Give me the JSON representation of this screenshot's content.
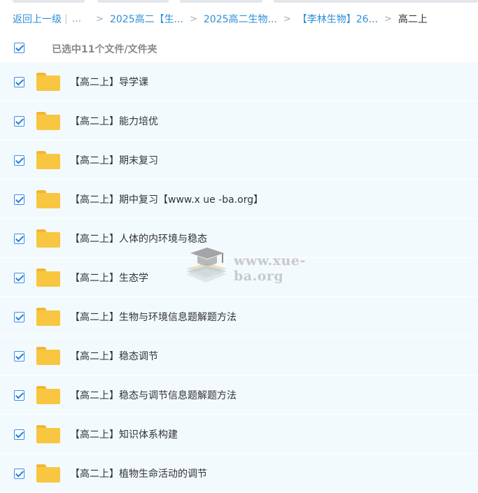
{
  "breadcrumb": {
    "back": "返回上一级",
    "ellipsis": "...",
    "crumbs": [
      "2025高二【生...",
      "2025高二生物...",
      "【李林生物】26..."
    ],
    "current": "高二上"
  },
  "selection": {
    "summary": "已选中11个文件/文件夹",
    "all_checked": true
  },
  "files": [
    {
      "name": "【高二上】导学课",
      "checked": true,
      "icon": "folder-icon"
    },
    {
      "name": "【高二上】能力培优",
      "checked": true,
      "icon": "folder-icon"
    },
    {
      "name": "【高二上】期末复习",
      "checked": true,
      "icon": "folder-icon"
    },
    {
      "name": "【高二上】期中复习【www.x ue -ba.org】",
      "checked": true,
      "icon": "folder-icon"
    },
    {
      "name": "【高二上】人体的内环境与稳态",
      "checked": true,
      "icon": "folder-icon"
    },
    {
      "name": "【高二上】生态学",
      "checked": true,
      "icon": "folder-icon"
    },
    {
      "name": "【高二上】生物与环境信息题解题方法",
      "checked": true,
      "icon": "folder-icon"
    },
    {
      "name": "【高二上】稳态调节",
      "checked": true,
      "icon": "folder-icon"
    },
    {
      "name": "【高二上】稳态与调节信息题解题方法",
      "checked": true,
      "icon": "folder-icon"
    },
    {
      "name": "【高二上】知识体系构建",
      "checked": true,
      "icon": "folder-icon"
    },
    {
      "name": "【高二上】植物生命活动的调节",
      "checked": true,
      "icon": "folder-icon"
    }
  ],
  "watermark": {
    "text": "www.xue-ba.org",
    "icon": "graduation-cap-books-icon"
  },
  "colors": {
    "link": "#2f8fd6",
    "row_bg": "#f3fafe",
    "checkbox": "#1f7fd8",
    "folder": "#f8c640"
  }
}
